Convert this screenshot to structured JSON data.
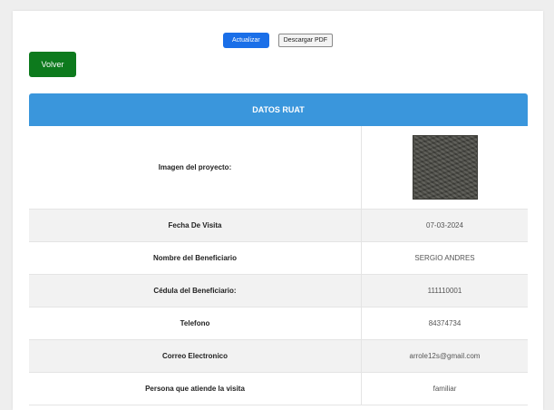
{
  "toolbar": {
    "update_label": "Actualizar",
    "pdf_label": "Descargar PDF",
    "back_label": "Volver"
  },
  "table": {
    "header": "DATOS RUAT",
    "image_row": {
      "label": "Imagen del proyecto:",
      "image_icon": "project-photo"
    },
    "rows": [
      {
        "label": "Fecha De Visita",
        "value": "07-03-2024"
      },
      {
        "label": "Nombre del Beneficiario",
        "value": "SERGIO ANDRES"
      },
      {
        "label": "Cédula del Beneficiario:",
        "value": "111110001"
      },
      {
        "label": "Telefono",
        "value": "84374734"
      },
      {
        "label": "Correo Electronico",
        "value": "arrole12s@gmail.com"
      },
      {
        "label": "Persona que atiende la visita",
        "value": "familiar"
      }
    ]
  },
  "colors": {
    "primary_button": "#1a6fe8",
    "back_button": "#0d7a1d",
    "table_header": "#3a96dc"
  }
}
